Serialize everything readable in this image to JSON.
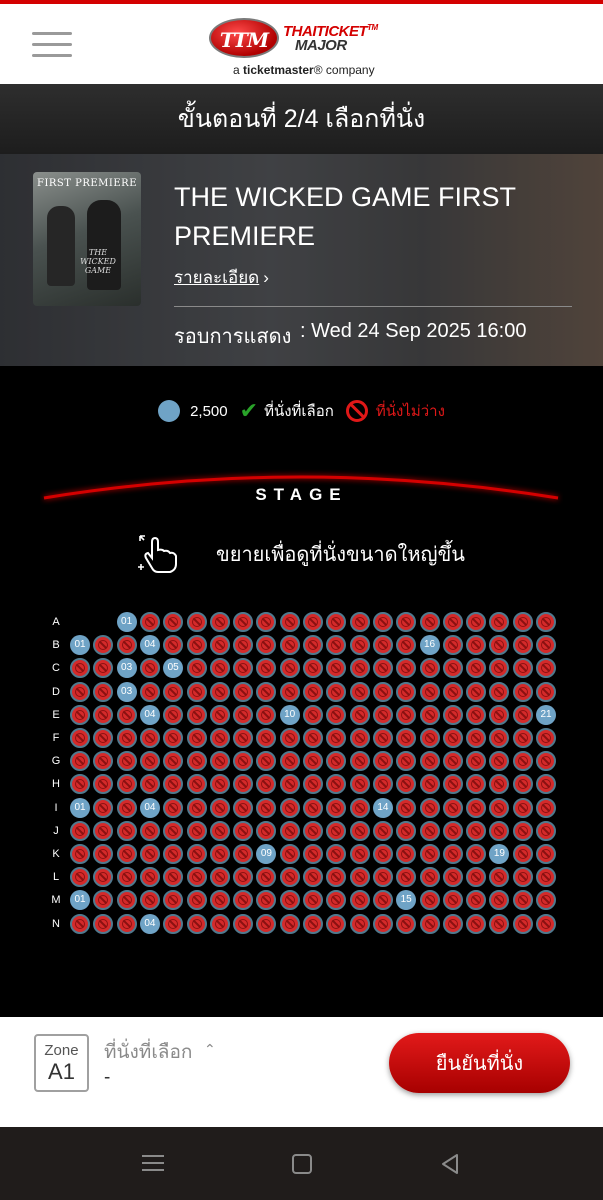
{
  "header": {
    "logo_badge": "TTM",
    "logo_name_line1": "THAITICKET",
    "logo_tm": "TM",
    "logo_name_line2": "MAJOR",
    "logo_tagline_prefix": "a ",
    "logo_tagline_brand": "ticketmaster",
    "logo_tagline_suffix": "® company"
  },
  "step": {
    "title": "ขั้นตอนที่ 2/4 เลือกที่นั่ง"
  },
  "event": {
    "poster_title": "FIRST PREMIERE",
    "poster_subtitle": "THE WICKED GAME",
    "name": "THE WICKED GAME FIRST PREMIERE",
    "details_link": "รายละเอียด",
    "showtime_label": "รอบการแสดง",
    "showtime_value": ": Wed 24 Sep 2025 16:00"
  },
  "legend": {
    "price": "2,500",
    "selected_label": "ที่นั่งที่เลือก",
    "unavailable_label": "ที่นั่งไม่ว่าง",
    "available_color": "#6fa3c6",
    "selected_color": "#29a329",
    "unavailable_color": "#e01818"
  },
  "stage": {
    "label": "STAGE",
    "accent": "#d40000"
  },
  "zoom_hint": {
    "text": "ขยายเพื่อดูที่นั่งขนาดใหญ่ขึ้น",
    "icon": "hand-pinch-icon"
  },
  "seatmap": {
    "columns_per_row": 21,
    "rows": [
      {
        "label": "A",
        "seats_start_col": 3,
        "available": [
          "01"
        ]
      },
      {
        "label": "B",
        "seats_start_col": 1,
        "available": [
          "01",
          "04",
          "16"
        ]
      },
      {
        "label": "C",
        "seats_start_col": 1,
        "available": [
          "03",
          "05"
        ]
      },
      {
        "label": "D",
        "seats_start_col": 1,
        "available": [
          "03"
        ]
      },
      {
        "label": "E",
        "seats_start_col": 1,
        "available": [
          "04",
          "10",
          "21"
        ]
      },
      {
        "label": "F",
        "seats_start_col": 1,
        "available": []
      },
      {
        "label": "G",
        "seats_start_col": 1,
        "available": []
      },
      {
        "label": "H",
        "seats_start_col": 1,
        "available": []
      },
      {
        "label": "I",
        "seats_start_col": 1,
        "available": [
          "01",
          "04",
          "14"
        ]
      },
      {
        "label": "J",
        "seats_start_col": 1,
        "available": []
      },
      {
        "label": "K",
        "seats_start_col": 1,
        "available": [
          "09",
          "19"
        ]
      },
      {
        "label": "L",
        "seats_start_col": 1,
        "available": []
      },
      {
        "label": "M",
        "seats_start_col": 1,
        "available": [
          "01",
          "15"
        ]
      },
      {
        "label": "N",
        "seats_start_col": 1,
        "available": [
          "04"
        ]
      }
    ]
  },
  "footer": {
    "zone_label": "Zone",
    "zone_value": "A1",
    "selected_seats_label": "ที่นั่งที่เลือก",
    "selected_seats_value": "-",
    "confirm_label": "ยืนยันที่นั่ง"
  },
  "system_nav": {
    "menu_icon": "recent-apps-icon",
    "home_icon": "home-icon",
    "back_icon": "back-icon"
  }
}
